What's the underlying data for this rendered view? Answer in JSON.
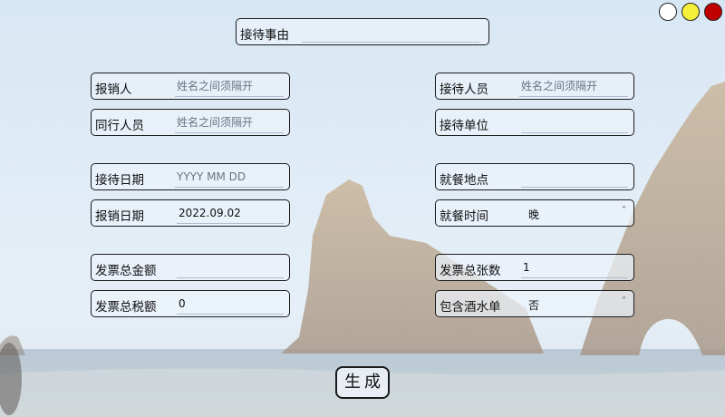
{
  "window_controls": [
    {
      "color": "#ffffff"
    },
    {
      "color": "#f5f03a"
    },
    {
      "color": "#c00000"
    }
  ],
  "reason": {
    "label": "接待事由",
    "value": ""
  },
  "left_fields": {
    "reimburser": {
      "label": "报销人",
      "placeholder": "姓名之间须隔开"
    },
    "companions": {
      "label": "同行人员",
      "placeholder": "姓名之间须隔开"
    },
    "reception_date": {
      "label": "接待日期",
      "placeholder": "YYYY MM DD"
    },
    "reimburse_date": {
      "label": "报销日期",
      "value": "2022.09.02"
    },
    "invoice_total_amount": {
      "label": "发票总金额",
      "value": ""
    },
    "invoice_total_tax": {
      "label": "发票总税额",
      "value": "0"
    }
  },
  "right_fields": {
    "reception_staff": {
      "label": "接待人员",
      "placeholder": "姓名之间须隔开"
    },
    "reception_unit": {
      "label": "接待单位",
      "value": ""
    },
    "dining_place": {
      "label": "就餐地点",
      "value": ""
    },
    "dining_time": {
      "label": "就餐时间",
      "selected": "晚"
    },
    "invoice_count": {
      "label": "发票总张数",
      "value": "1"
    },
    "includes_alcohol": {
      "label": "包含酒水单",
      "selected": "否"
    }
  },
  "generate_button": {
    "label": "生成"
  }
}
